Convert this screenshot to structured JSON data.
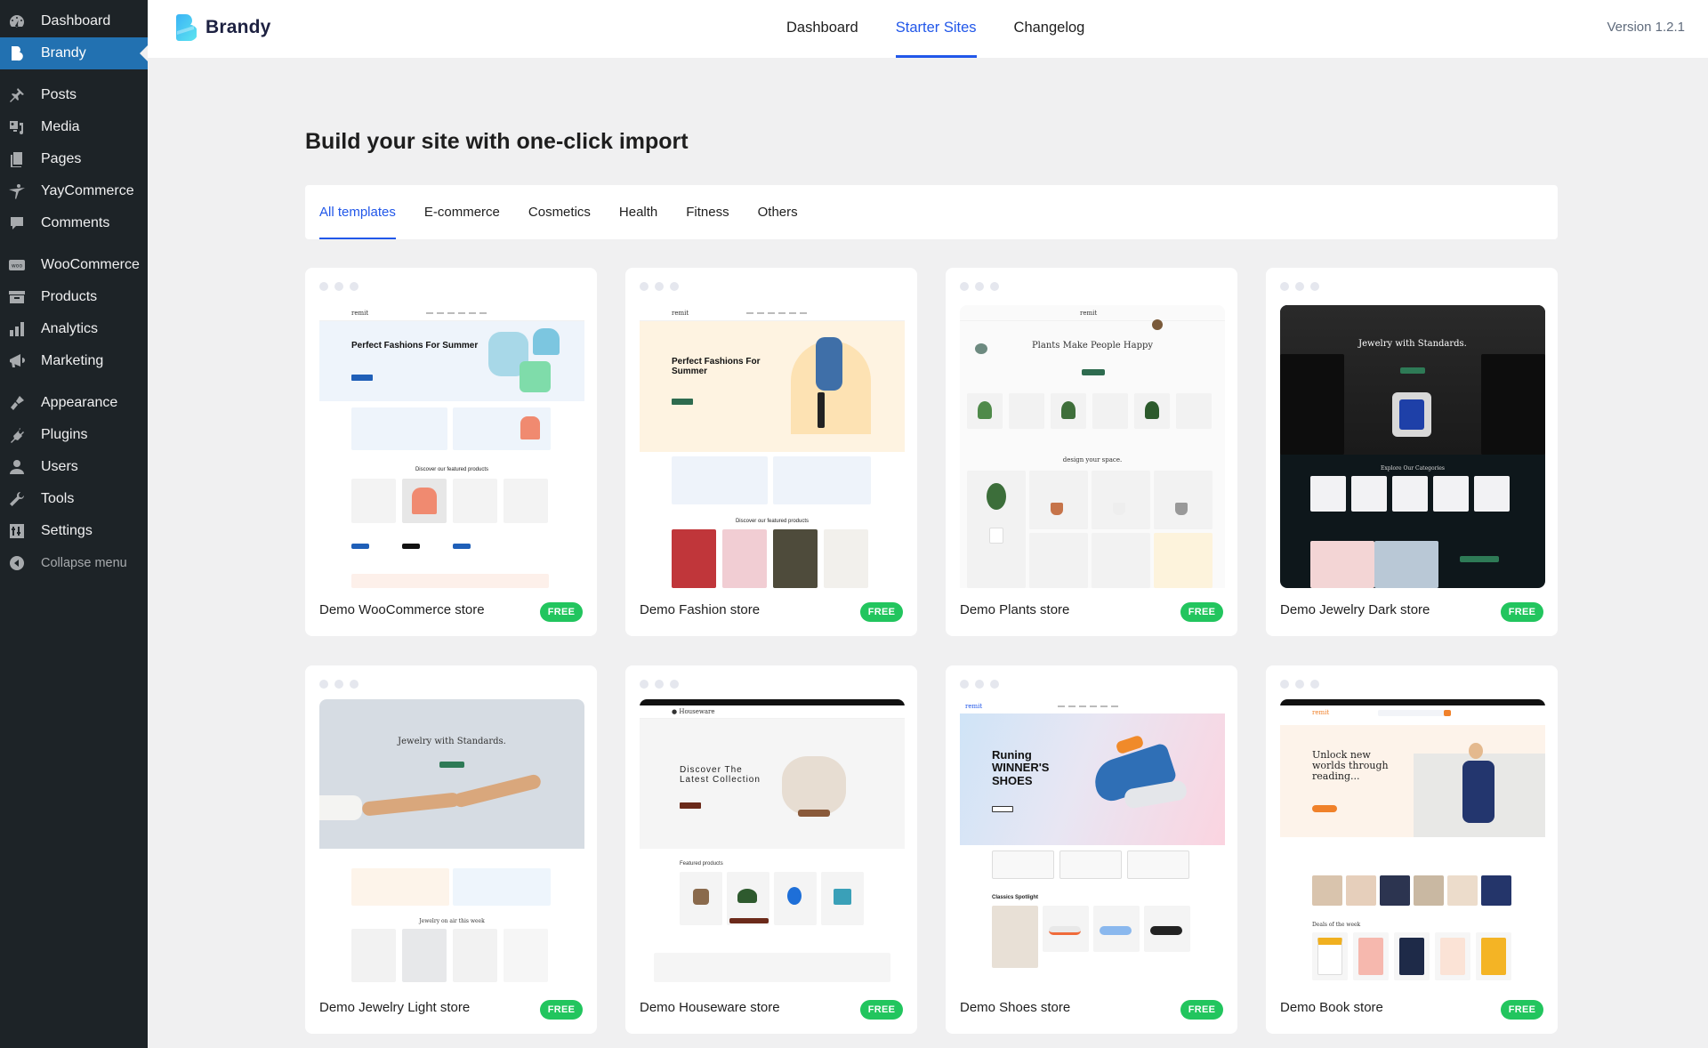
{
  "sidebar": {
    "items": [
      {
        "label": "Dashboard",
        "icon": "dashboard-icon"
      },
      {
        "label": "Brandy",
        "icon": "brandy-icon",
        "active": true
      },
      {
        "label": "Posts",
        "icon": "pin-icon"
      },
      {
        "label": "Media",
        "icon": "media-icon"
      },
      {
        "label": "Pages",
        "icon": "pages-icon"
      },
      {
        "label": "YayCommerce",
        "icon": "yaycommerce-icon"
      },
      {
        "label": "Comments",
        "icon": "comment-icon"
      },
      {
        "label": "WooCommerce",
        "icon": "woo-icon"
      },
      {
        "label": "Products",
        "icon": "archive-icon"
      },
      {
        "label": "Analytics",
        "icon": "bar-chart-icon"
      },
      {
        "label": "Marketing",
        "icon": "megaphone-icon"
      },
      {
        "label": "Appearance",
        "icon": "paintbrush-icon"
      },
      {
        "label": "Plugins",
        "icon": "plug-icon"
      },
      {
        "label": "Users",
        "icon": "user-icon"
      },
      {
        "label": "Tools",
        "icon": "wrench-icon"
      },
      {
        "label": "Settings",
        "icon": "sliders-icon"
      },
      {
        "label": "Collapse menu",
        "icon": "collapse-arrow-icon"
      }
    ]
  },
  "header": {
    "brand": "Brandy",
    "nav": [
      {
        "label": "Dashboard"
      },
      {
        "label": "Starter Sites",
        "active": true
      },
      {
        "label": "Changelog"
      }
    ],
    "version": "Version 1.2.1"
  },
  "main": {
    "title": "Build your site with one-click import",
    "tabs": [
      {
        "label": "All templates",
        "active": true
      },
      {
        "label": "E-commerce"
      },
      {
        "label": "Cosmetics"
      },
      {
        "label": "Health"
      },
      {
        "label": "Fitness"
      },
      {
        "label": "Others"
      }
    ],
    "badge_color": "#22c55e",
    "accent_color": "#2157e9",
    "cards": [
      {
        "title": "Demo WooCommerce store",
        "badge": "FREE",
        "preview": {
          "headline": "Perfect Fashions For Summer",
          "section": "Discover our featured products"
        }
      },
      {
        "title": "Demo Fashion store",
        "badge": "FREE",
        "preview": {
          "headline": "Perfect Fashions For Summer",
          "section": "Discover our featured products"
        }
      },
      {
        "title": "Demo Plants store",
        "badge": "FREE",
        "preview": {
          "headline": "Plants Make People Happy",
          "section": "design your space."
        }
      },
      {
        "title": "Demo Jewelry Dark store",
        "badge": "FREE",
        "preview": {
          "headline": "Jewelry with Standards.",
          "section": "Explore Our Categories"
        }
      },
      {
        "title": "Demo Jewelry Light store",
        "badge": "FREE",
        "preview": {
          "headline": "Jewelry with Standards.",
          "section": "Jewelry on air this week"
        }
      },
      {
        "title": "Demo Houseware store",
        "badge": "FREE",
        "preview": {
          "headline": "Discover The Latest Collection",
          "section": "Featured products"
        }
      },
      {
        "title": "Demo Shoes store",
        "badge": "FREE",
        "preview": {
          "headline": "Runing WINNER'S SHOES",
          "section": "Classics Spotlight"
        }
      },
      {
        "title": "Demo Book store",
        "badge": "FREE",
        "preview": {
          "headline": "Unlock new worlds through reading...",
          "section": "Deals of the week"
        }
      }
    ]
  }
}
